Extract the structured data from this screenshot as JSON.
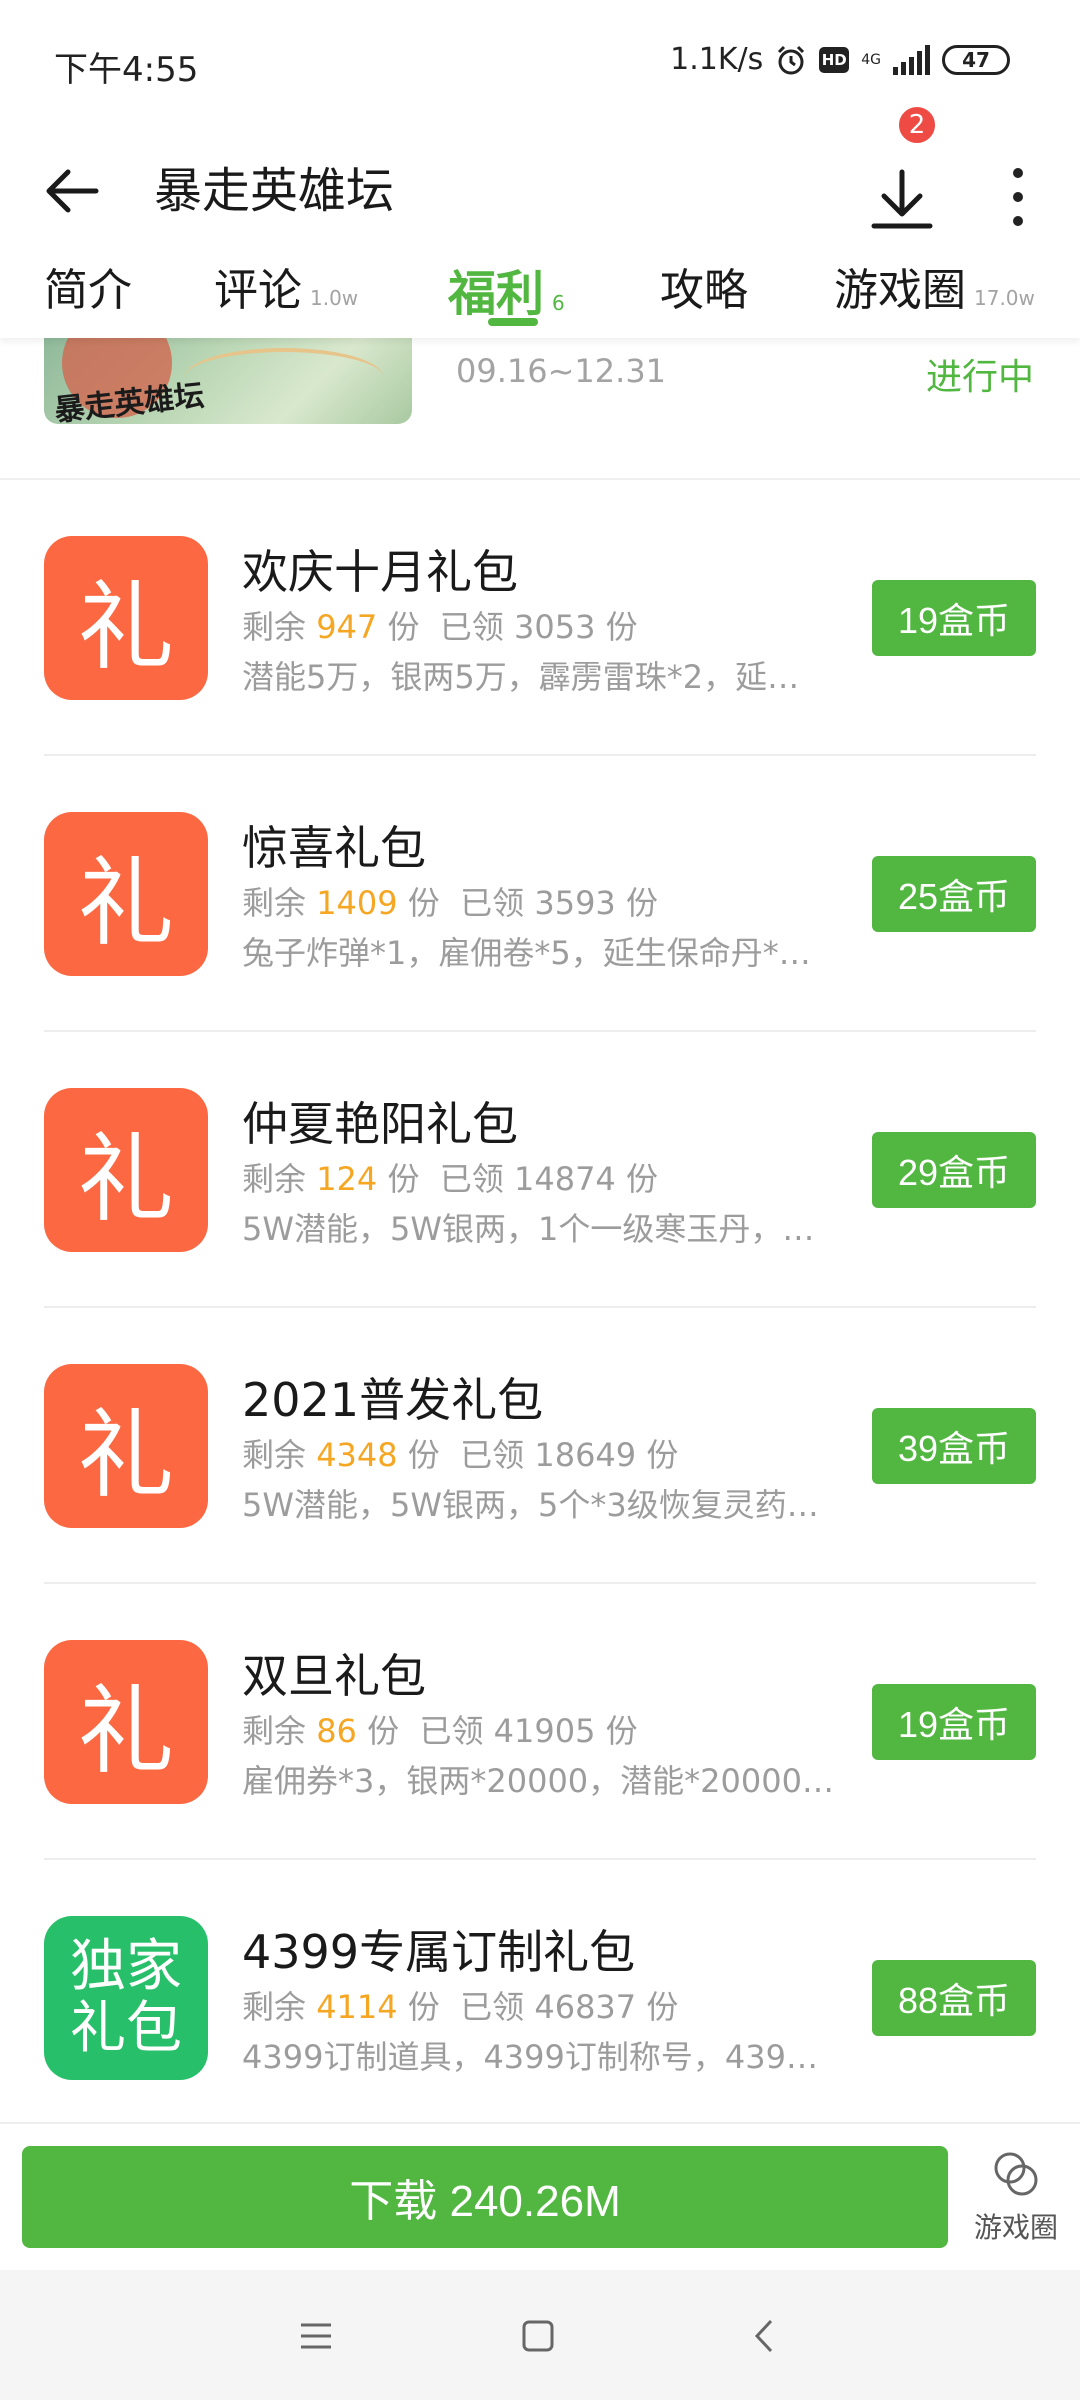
{
  "status_bar": {
    "time": "下午4:55",
    "net_speed": "1.1K/s",
    "network": "4G",
    "battery": "47"
  },
  "header": {
    "title": "暴走英雄坛",
    "download_badge": "2",
    "back_icon": "back-arrow-icon",
    "download_icon": "download-icon",
    "more_icon": "more-vertical-icon"
  },
  "tabs": [
    {
      "label": "简介",
      "count": ""
    },
    {
      "label": "评论",
      "count": "1.0w"
    },
    {
      "label": "福利",
      "count": "6",
      "active": true
    },
    {
      "label": "攻略",
      "count": ""
    },
    {
      "label": "游戏圈",
      "count": "17.0w"
    }
  ],
  "banner": {
    "date_range": "09.16~12.31",
    "status": "进行中",
    "logo_text": "暴走英雄坛"
  },
  "gifts": [
    {
      "icon_text": "礼",
      "name": "欢庆十月礼包",
      "remain_label": "剩余",
      "remain": "947",
      "unit": "份",
      "claimed_label": "已领",
      "claimed": "3053",
      "desc": "潜能5万，银两5万，霹雳雷珠*2，延…",
      "price": "19盒币"
    },
    {
      "icon_text": "礼",
      "name": "惊喜礼包",
      "remain_label": "剩余",
      "remain": "1409",
      "unit": "份",
      "claimed_label": "已领",
      "claimed": "3593",
      "desc": "兔子炸弹*1，雇佣卷*5，延生保命丹*…",
      "price": "25盒币"
    },
    {
      "icon_text": "礼",
      "name": "仲夏艳阳礼包",
      "remain_label": "剩余",
      "remain": "124",
      "unit": "份",
      "claimed_label": "已领",
      "claimed": "14874",
      "desc": "5W潜能，5W银两，1个一级寒玉丹，…",
      "price": "29盒币"
    },
    {
      "icon_text": "礼",
      "name": "2021普发礼包",
      "remain_label": "剩余",
      "remain": "4348",
      "unit": "份",
      "claimed_label": "已领",
      "claimed": "18649",
      "desc": "5W潜能，5W银两，5个*3级恢复灵药…",
      "price": "39盒币"
    },
    {
      "icon_text": "礼",
      "name": "双旦礼包",
      "remain_label": "剩余",
      "remain": "86",
      "unit": "份",
      "claimed_label": "已领",
      "claimed": "41905",
      "desc": "雇佣券*3，银两*20000，潜能*20000…",
      "price": "19盒币"
    },
    {
      "icon_text_line1": "独家",
      "icon_text_line2": "礼包",
      "name": "4399专属订制礼包",
      "remain_label": "剩余",
      "remain": "4114",
      "unit": "份",
      "claimed_label": "已领",
      "claimed": "46837",
      "desc": "4399订制道具，4399订制称号，439…",
      "price": "88盒币"
    }
  ],
  "bottom": {
    "download_label": "下载 240.26M",
    "circle_label": "游戏圈"
  },
  "colors": {
    "accent_green": "#52b740",
    "gift_orange": "#fb6841",
    "gift_green": "#28bf6b",
    "remain_yellow": "#f5a623",
    "badge_red": "#ef4b45"
  }
}
